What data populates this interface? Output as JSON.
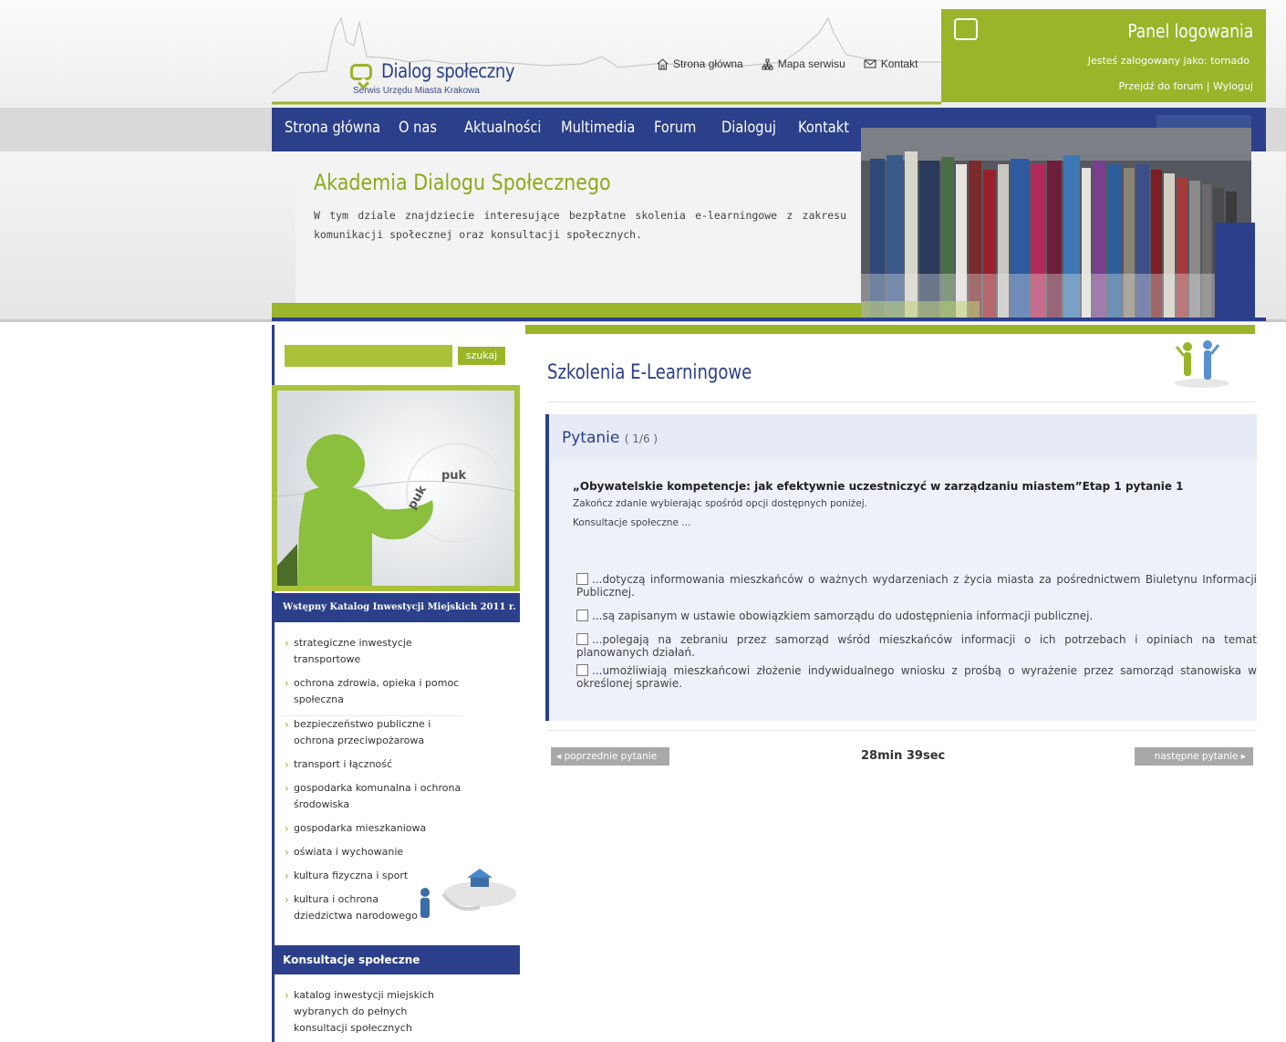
{
  "header": {
    "logo_title": "Dialog społeczny",
    "logo_subtitle": "Serwis Urzędu Miasta Krakowa",
    "toplinks": [
      {
        "label": "Strona główna",
        "icon": "home-icon"
      },
      {
        "label": "Mapa serwisu",
        "icon": "sitemap-icon"
      },
      {
        "label": "Kontakt",
        "icon": "mail-icon"
      }
    ],
    "login": {
      "title": "Panel logowania",
      "user_text": "Jesteś zalogowany jako: tornado",
      "forum_link": "Przejdź do forum",
      "separator": "|",
      "logout_link": "Wyloguj",
      "icon": "login-icon"
    }
  },
  "nav": {
    "items": [
      "Strona główna",
      "O nas",
      "Aktualności",
      "Multimedia",
      "Forum",
      "Dialoguj",
      "Kontakt"
    ]
  },
  "banner": {
    "title": "Akademia Dialogu Społecznego",
    "text": "W tym dziale znajdziecie interesujące bezpłatne skolenia e-learningowe z zakresu komunikacji społecznej oraz konsultacji społecznych."
  },
  "sidebar": {
    "search_placeholder": "",
    "search_button": "szukaj",
    "promo_text_1": "puk",
    "promo_text_2": "puk",
    "section1_title": "Wstępny Katalog Inwestycji Miejskich 2011 r.",
    "section1_items": [
      "strategiczne inwestycje transportowe",
      "ochrona zdrowia, opieka i pomoc społeczna",
      "bezpieczeństwo publiczne i ochrona przeciwpożarowa",
      "transport i łączność",
      "gospodarka komunalna i ochrona środowiska",
      "gospodarka mieszkaniowa",
      "oświata i wychowanie",
      "kultura fizyczna i sport",
      "kultura i ochrona dziedzictwa narodowego"
    ],
    "section2_title": "Konsultacje społeczne",
    "section2_items": [
      "katalog inwestycji miejskich wybranych do pełnych konsultacji społecznych"
    ]
  },
  "main": {
    "page_title": "Szkolenia E-Learningowe",
    "question": {
      "label": "Pytanie",
      "counter": "( 1/6 )",
      "title": "„Obywatelskie kompetencje: jak efektywnie uczestniczyć w zarządzaniu miastem”Etap 1 pytanie 1",
      "instruction": "Zakończ zdanie wybierając spośród opcji dostępnych poniżej.",
      "stem": "Konsultacje społeczne ...",
      "answers": [
        "...dotyczą informowania mieszkańców o ważnych wydarzeniach z życia miasta za pośrednictwem Biuletynu Informacji Publicznej.",
        "...są zapisanym w ustawie obowiązkiem samorządu do udostępnienia informacji publicznej.",
        "...polegają na zebraniu przez samorząd wśród mieszkańców informacji o ich potrzebach i opiniach na temat planowanych działań.",
        "...umożliwiają mieszkańcowi złożenie indywidualnego wniosku z prośbą o wyrażenie przez samorząd stanowiska w określonej sprawie."
      ]
    },
    "pager": {
      "prev_label": "◂ poprzednie pytanie",
      "timer": "28min 39sec",
      "next_label": "następne pytanie ▸"
    }
  },
  "colors": {
    "brand_blue": "#2b3f8a",
    "brand_green": "#9ab52a",
    "question_bg": "#eef1f9"
  }
}
